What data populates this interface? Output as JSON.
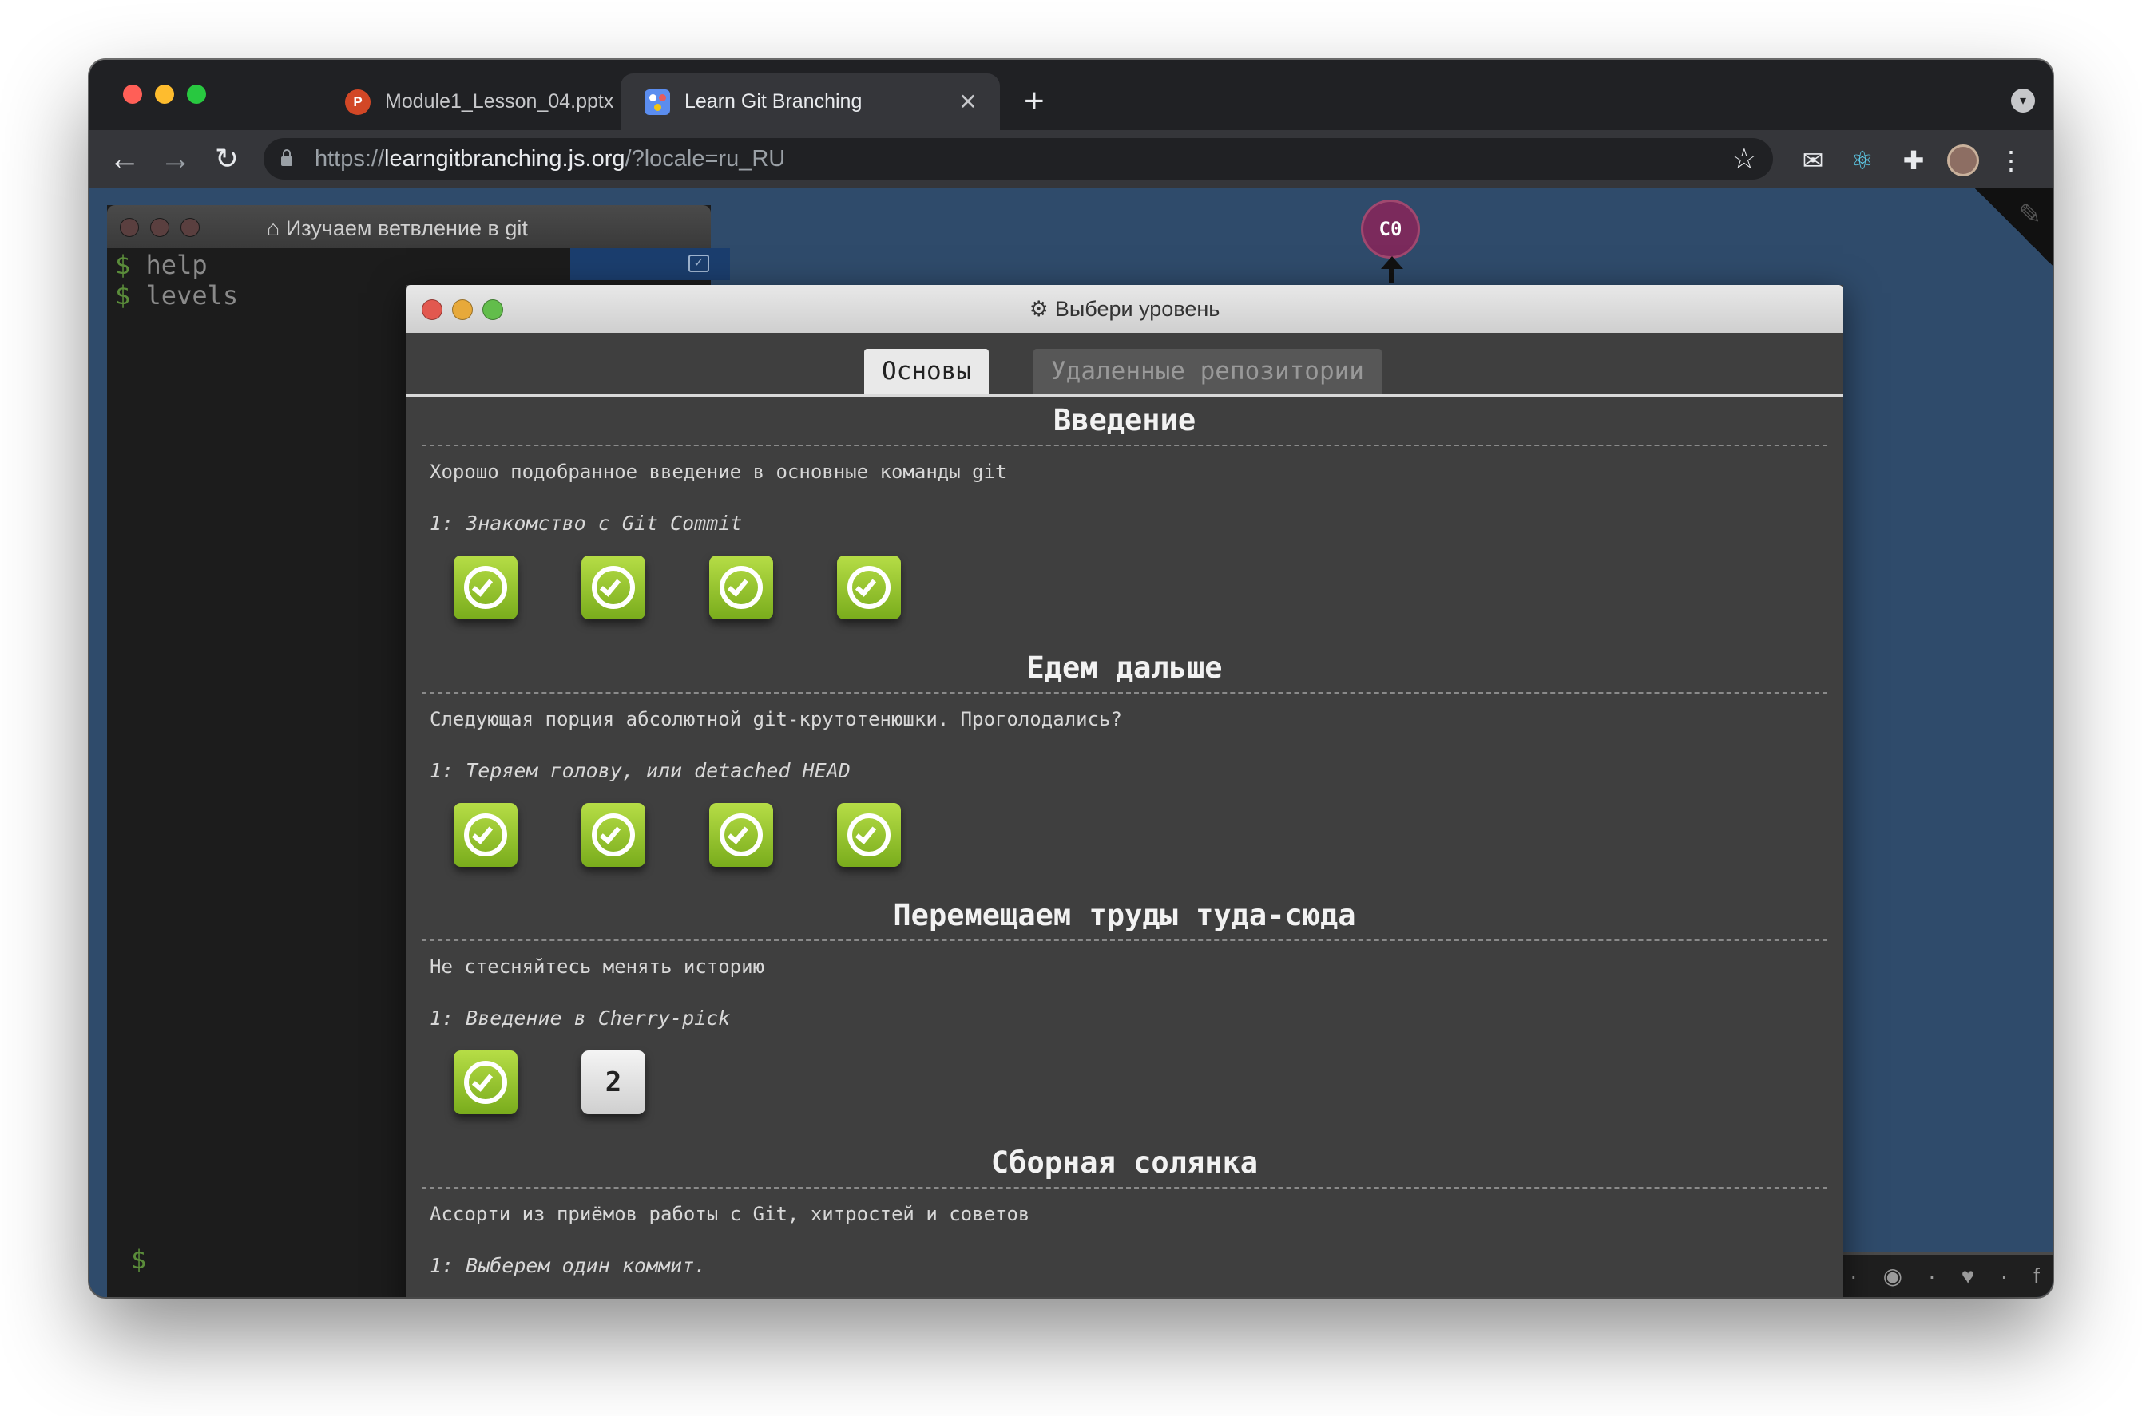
{
  "browser": {
    "tabs": [
      {
        "title": "Module1_Lesson_04.pptx",
        "favicon": "powerpoint-icon",
        "favicon_letter": "P",
        "active": false
      },
      {
        "title": "Learn Git Branching",
        "favicon": "git-branching-icon",
        "active": true
      }
    ],
    "close_glyph": "✕",
    "new_tab_glyph": "+",
    "url_scheme": "https://",
    "url_host": "learngitbranching.js.org",
    "url_rest": "/?locale=ru_RU"
  },
  "terminal": {
    "title": "Изучаем ветвление в git",
    "prompt": "$",
    "lines": [
      "help",
      "levels"
    ]
  },
  "graph": {
    "commit_label": "C0",
    "commit_color": "#7b2a5c"
  },
  "modal": {
    "title": "Выбери уровень",
    "tabs": [
      {
        "label": "Основы",
        "active": true
      },
      {
        "label": "Удаленные репозитории",
        "active": false
      }
    ],
    "sequences": [
      {
        "title": "Введение",
        "about": "Хорошо подобранное введение в основные команды git",
        "level_name": "1: Знакомство с Git Commit",
        "levels": [
          {
            "done": true
          },
          {
            "done": true
          },
          {
            "done": true
          },
          {
            "done": true
          }
        ]
      },
      {
        "title": "Едем дальше",
        "about": "Следующая порция абсолютной git-крутотенюшки. Проголодались?",
        "level_name": "1: Теряем голову, или detached HEAD",
        "levels": [
          {
            "done": true
          },
          {
            "done": true
          },
          {
            "done": true
          },
          {
            "done": true
          }
        ]
      },
      {
        "title": "Перемещаем труды туда-сюда",
        "about": "Не стесняйтесь менять историю",
        "level_name": "1: Введение в Cherry-pick",
        "levels": [
          {
            "done": true
          },
          {
            "done": false,
            "number": "2"
          }
        ]
      },
      {
        "title": "Сборная солянка",
        "about": "Ассорти из приёмов работы с Git, хитростей и советов",
        "level_name": "1: Выберем один коммит.",
        "levels": []
      }
    ]
  },
  "colors": {
    "accent_done": "#8fc12e",
    "background": "#2f4b6b"
  }
}
